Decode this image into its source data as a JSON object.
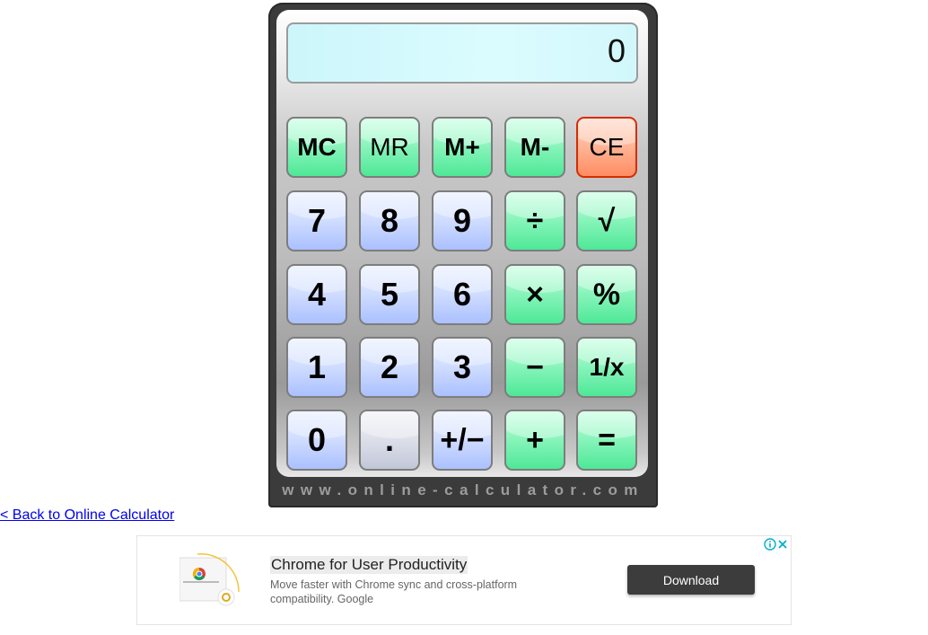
{
  "display": {
    "value": "0"
  },
  "brand": "www.online-calculator.com",
  "keys": {
    "mc": "MC",
    "mr": "MR",
    "mplus": "M+",
    "mminus": "M-",
    "ce": "CE",
    "seven": "7",
    "eight": "8",
    "nine": "9",
    "divide": "÷",
    "sqrt": "√",
    "four": "4",
    "five": "5",
    "six": "6",
    "multiply": "×",
    "percent": "%",
    "one": "1",
    "two": "2",
    "three": "3",
    "minus": "−",
    "reciprocal": "1/x",
    "zero": "0",
    "decimal": ".",
    "plusminus": "+/−",
    "plus": "+",
    "equals": "="
  },
  "back_link": "< Back to Online Calculator",
  "ad": {
    "title": "Chrome for User Productivity",
    "description": "Move faster with Chrome sync and cross-platform compatibility. Google",
    "button": "Download",
    "thumb_icon": "chrome-logo-icon",
    "info_icon": "ad-info-icon",
    "close_icon": "ad-close-icon"
  },
  "colors": {
    "memory_key": "#8cf5bd",
    "number_key": "#cfdcff",
    "clear_key": "#ff9c78",
    "display_bg": "#d6fafd",
    "ad_button": "#3c3c3c",
    "link": "#0000ee"
  }
}
